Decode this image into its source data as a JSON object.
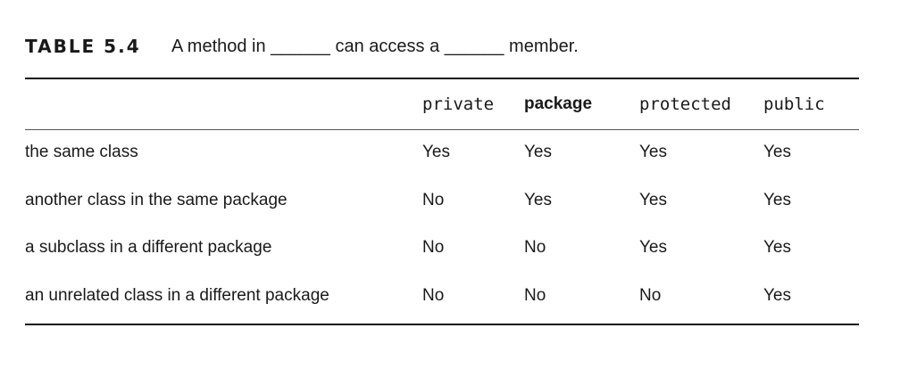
{
  "caption": {
    "label": "TABLE 5.4",
    "text": "A method in ______ can access a ______ member."
  },
  "table": {
    "columns": [
      {
        "label": "private",
        "style": "mono"
      },
      {
        "label": "package",
        "style": "bold"
      },
      {
        "label": "protected",
        "style": "mono"
      },
      {
        "label": "public",
        "style": "mono"
      }
    ],
    "rows": [
      {
        "label": "the same class",
        "cells": [
          "Yes",
          "Yes",
          "Yes",
          "Yes"
        ]
      },
      {
        "label": "another class in the same package",
        "cells": [
          "No",
          "Yes",
          "Yes",
          "Yes"
        ]
      },
      {
        "label": "a subclass in a different package",
        "cells": [
          "No",
          "No",
          "Yes",
          "Yes"
        ]
      },
      {
        "label": "an unrelated class in a different package",
        "cells": [
          "No",
          "No",
          "No",
          "Yes"
        ]
      }
    ]
  }
}
